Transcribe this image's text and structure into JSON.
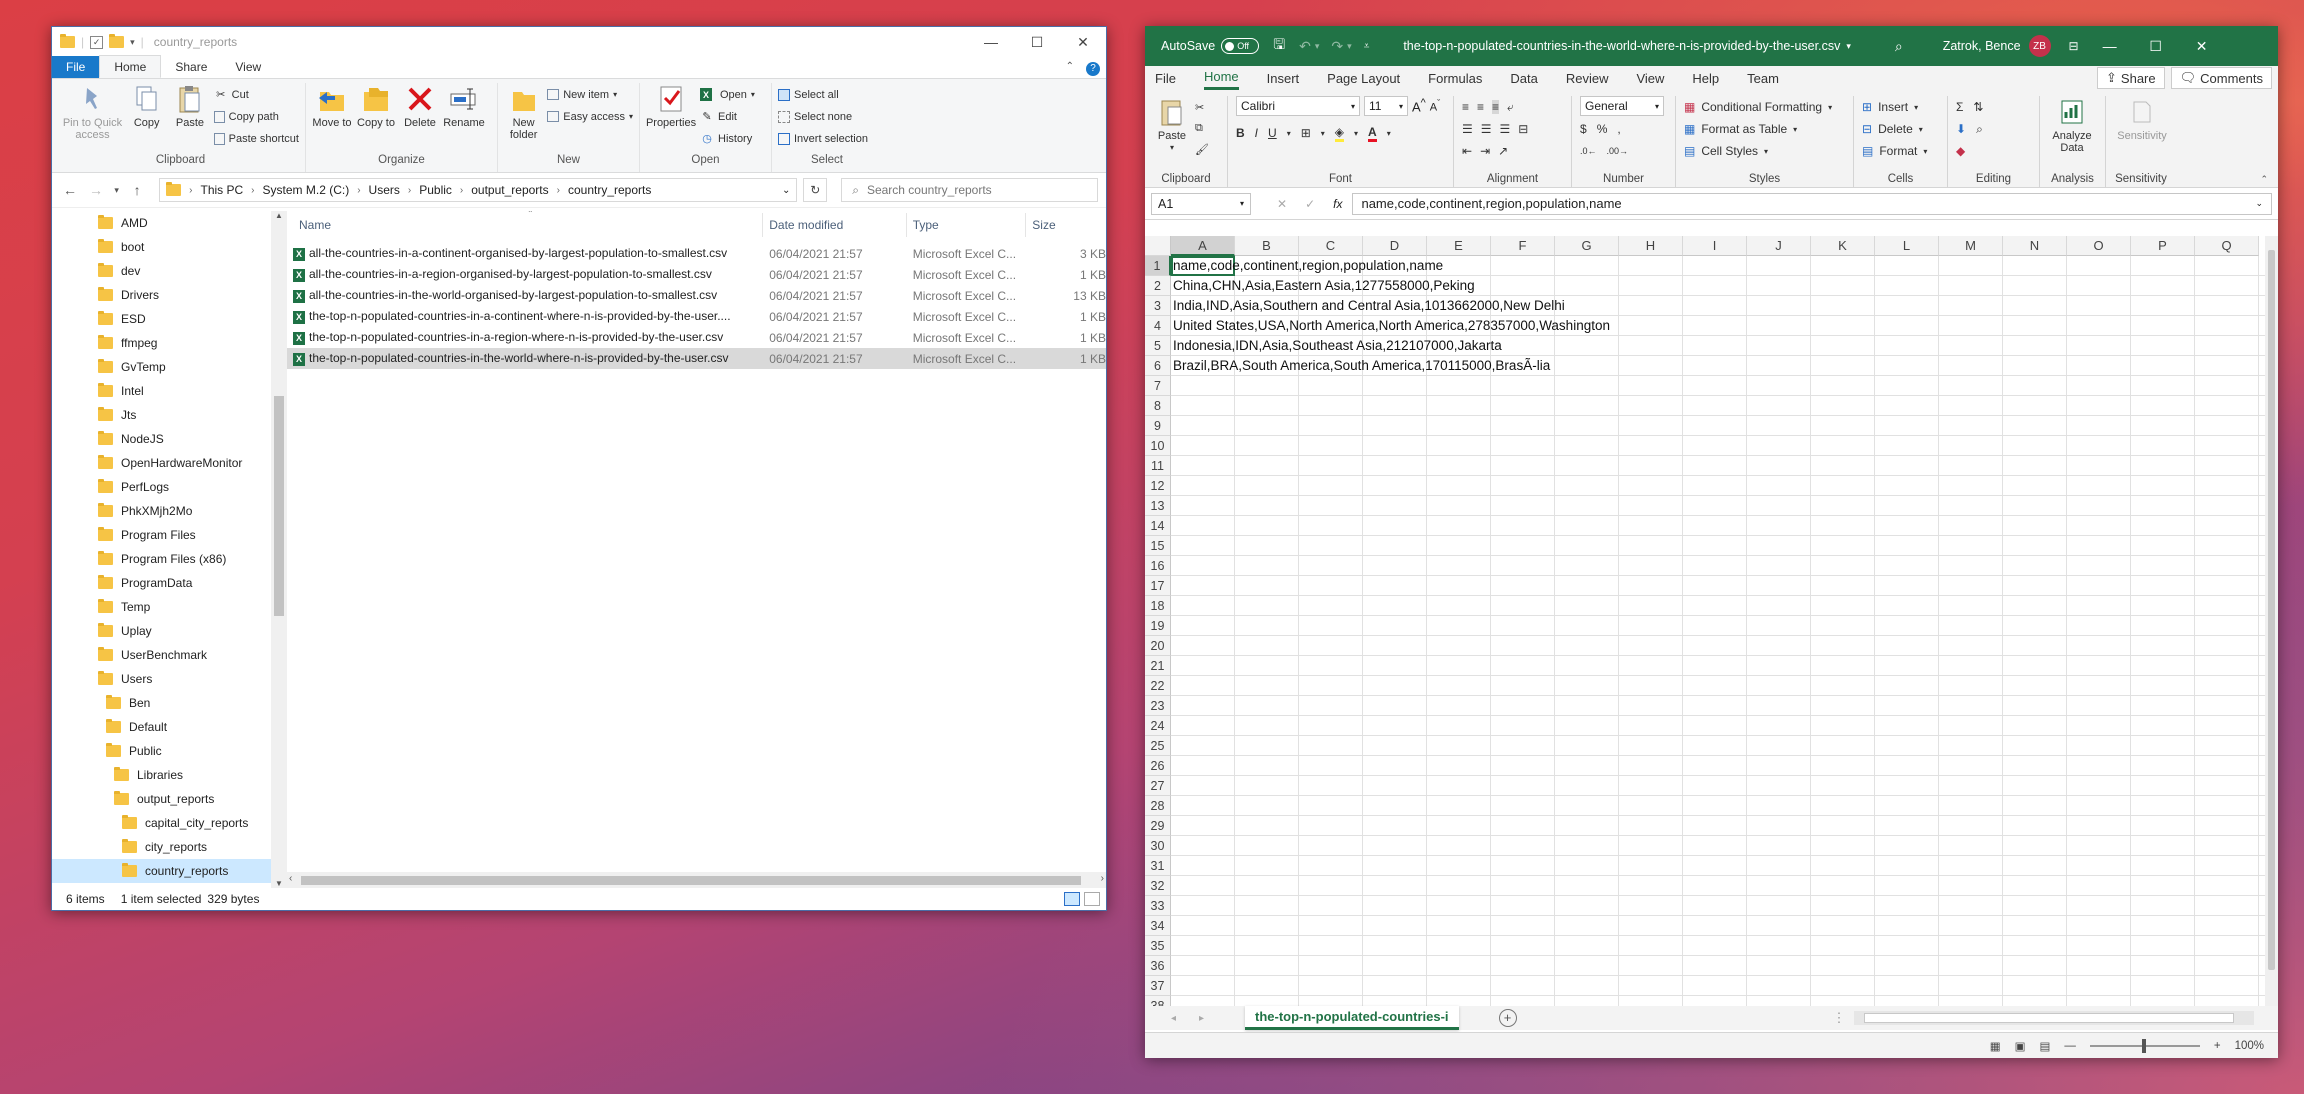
{
  "explorer": {
    "title": "country_reports",
    "tabs": [
      "File",
      "Home",
      "Share",
      "View"
    ],
    "ribbon": {
      "clipboard": {
        "label": "Clipboard",
        "pin": "Pin to Quick access",
        "copy": "Copy",
        "paste": "Paste",
        "cut": "Cut",
        "copy_path": "Copy path",
        "paste_shortcut": "Paste shortcut"
      },
      "organize": {
        "label": "Organize",
        "move_to": "Move to",
        "copy_to": "Copy to",
        "delete": "Delete",
        "rename": "Rename"
      },
      "new": {
        "label": "New",
        "new_folder": "New folder",
        "new_item": "New item",
        "easy_access": "Easy access"
      },
      "open": {
        "label": "Open",
        "properties": "Properties",
        "open": "Open",
        "edit": "Edit",
        "history": "History"
      },
      "select": {
        "label": "Select",
        "select_all": "Select all",
        "select_none": "Select none",
        "invert": "Invert selection"
      }
    },
    "breadcrumb": [
      "This PC",
      "System M.2 (C:)",
      "Users",
      "Public",
      "output_reports",
      "country_reports"
    ],
    "search_placeholder": "Search country_reports",
    "tree": [
      {
        "label": "AMD",
        "indent": 0
      },
      {
        "label": "boot",
        "indent": 0
      },
      {
        "label": "dev",
        "indent": 0
      },
      {
        "label": "Drivers",
        "indent": 0
      },
      {
        "label": "ESD",
        "indent": 0
      },
      {
        "label": "ffmpeg",
        "indent": 0
      },
      {
        "label": "GvTemp",
        "indent": 0
      },
      {
        "label": "Intel",
        "indent": 0
      },
      {
        "label": "Jts",
        "indent": 0
      },
      {
        "label": "NodeJS",
        "indent": 0
      },
      {
        "label": "OpenHardwareMonitor",
        "indent": 0
      },
      {
        "label": "PerfLogs",
        "indent": 0
      },
      {
        "label": "PhkXMjh2Mo",
        "indent": 0
      },
      {
        "label": "Program Files",
        "indent": 0
      },
      {
        "label": "Program Files (x86)",
        "indent": 0
      },
      {
        "label": "ProgramData",
        "indent": 0
      },
      {
        "label": "Temp",
        "indent": 0
      },
      {
        "label": "Uplay",
        "indent": 0
      },
      {
        "label": "UserBenchmark",
        "indent": 0
      },
      {
        "label": "Users",
        "indent": 0
      },
      {
        "label": "Ben",
        "indent": 1
      },
      {
        "label": "Default",
        "indent": 1
      },
      {
        "label": "Public",
        "indent": 1
      },
      {
        "label": "Libraries",
        "indent": 2
      },
      {
        "label": "output_reports",
        "indent": 2
      },
      {
        "label": "capital_city_reports",
        "indent": 3
      },
      {
        "label": "city_reports",
        "indent": 3
      },
      {
        "label": "country_reports",
        "indent": 3
      }
    ],
    "columns": {
      "name": "Name",
      "date": "Date modified",
      "type": "Type",
      "size": "Size"
    },
    "files": [
      {
        "name": "all-the-countries-in-a-continent-organised-by-largest-population-to-smallest.csv",
        "date": "06/04/2021 21:57",
        "type": "Microsoft Excel C...",
        "size": "3 KB"
      },
      {
        "name": "all-the-countries-in-a-region-organised-by-largest-population-to-smallest.csv",
        "date": "06/04/2021 21:57",
        "type": "Microsoft Excel C...",
        "size": "1 KB"
      },
      {
        "name": "all-the-countries-in-the-world-organised-by-largest-population-to-smallest.csv",
        "date": "06/04/2021 21:57",
        "type": "Microsoft Excel C...",
        "size": "13 KB"
      },
      {
        "name": "the-top-n-populated-countries-in-a-continent-where-n-is-provided-by-the-user....",
        "date": "06/04/2021 21:57",
        "type": "Microsoft Excel C...",
        "size": "1 KB"
      },
      {
        "name": "the-top-n-populated-countries-in-a-region-where-n-is-provided-by-the-user.csv",
        "date": "06/04/2021 21:57",
        "type": "Microsoft Excel C...",
        "size": "1 KB"
      },
      {
        "name": "the-top-n-populated-countries-in-the-world-where-n-is-provided-by-the-user.csv",
        "date": "06/04/2021 21:57",
        "type": "Microsoft Excel C...",
        "size": "1 KB"
      }
    ],
    "status": {
      "items": "6 items",
      "selected": "1 item selected",
      "bytes": "329 bytes"
    }
  },
  "excel": {
    "autosave": "AutoSave",
    "autosave_state": "Off",
    "filename": "the-top-n-populated-countries-in-the-world-where-n-is-provided-by-the-user.csv",
    "user": "Zatrok, Bence",
    "initials": "ZB",
    "menu": [
      "File",
      "Home",
      "Insert",
      "Page Layout",
      "Formulas",
      "Data",
      "Review",
      "View",
      "Help",
      "Team"
    ],
    "share": "Share",
    "comments": "Comments",
    "ribbon": {
      "clipboard": "Clipboard",
      "paste": "Paste",
      "font_label": "Font",
      "font_name": "Calibri",
      "font_size": "11",
      "alignment": "Alignment",
      "number": "Number",
      "number_format": "General",
      "styles": "Styles",
      "cond_format": "Conditional Formatting",
      "format_table": "Format as Table",
      "cell_styles": "Cell Styles",
      "cells": "Cells",
      "insert": "Insert",
      "delete": "Delete",
      "format": "Format",
      "editing": "Editing",
      "analysis": "Analysis",
      "analyze": "Analyze Data",
      "sensitivity": "Sensitivity"
    },
    "namebox": "A1",
    "formula": "name,code,continent,region,population,name",
    "columns": [
      "A",
      "B",
      "C",
      "D",
      "E",
      "F",
      "G",
      "H",
      "I",
      "J",
      "K",
      "L",
      "M",
      "N",
      "O",
      "P",
      "Q"
    ],
    "rows": [
      "name,code,continent,region,population,name",
      "China,CHN,Asia,Eastern Asia,1277558000,Peking",
      "India,IND,Asia,Southern and Central Asia,1013662000,New Delhi",
      "United States,USA,North America,North America,278357000,Washington",
      "Indonesia,IDN,Asia,Southeast Asia,212107000,Jakarta",
      "Brazil,BRA,South America,South America,170115000,BrasÃ-lia"
    ],
    "row_count": 38,
    "sheet_tab": "the-top-n-populated-countries-i",
    "zoom": "100%"
  }
}
